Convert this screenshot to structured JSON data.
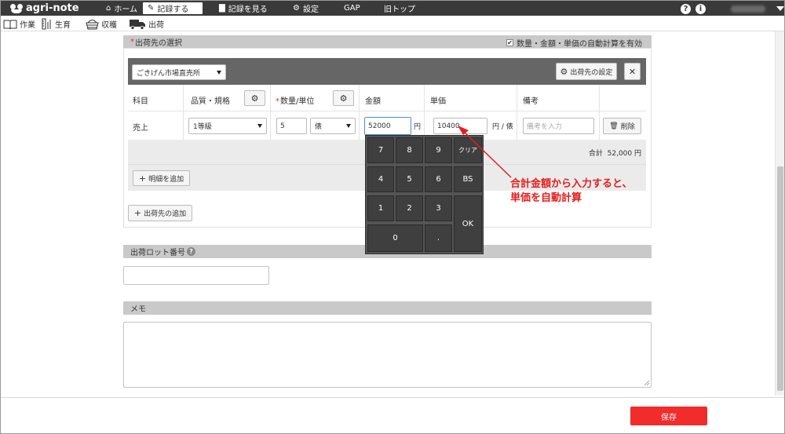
{
  "nav": {
    "brand": "agri-note",
    "home": "ホーム",
    "record": "記録する",
    "view": "記録を見る",
    "settings": "設定",
    "gap": "GAP",
    "old_top": "旧トップ"
  },
  "subnav": {
    "work": "作業",
    "growth": "生育",
    "harvest": "収穫",
    "shipping": "出荷"
  },
  "ship_section": {
    "title": "出荷先の選択",
    "auto_calc_label": "数量・金額・単価の自動計算を有効",
    "auto_calc_checked": true,
    "destination": "ごきげん市場直売所",
    "settings_button": "出荷先の設定",
    "close_button": "✕",
    "columns": {
      "subject": "科目",
      "quality": "品質・規格",
      "quantity": "数量/単位",
      "amount": "金額",
      "unit_price": "単価",
      "note": "備考"
    },
    "row": {
      "subject": "売上",
      "quality": "1等級",
      "quantity": "5",
      "unit": "俵",
      "amount": "52000",
      "amount_unit": "円",
      "unit_price": "10400",
      "unit_price_unit": "円 / 俵",
      "note_placeholder": "備考を入力",
      "delete_button": "削除"
    },
    "total_label": "合計",
    "total_value": "52,000 円",
    "add_line_button": "明細を追加",
    "add_destination_button": "出荷先の追加"
  },
  "numpad": {
    "keys": [
      "7",
      "8",
      "9",
      "クリア",
      "4",
      "5",
      "6",
      "BS",
      "1",
      "2",
      "3",
      "OK",
      "0",
      "."
    ]
  },
  "annotation": {
    "line1": "合計金額から入力すると、",
    "line2": "単価を自動計算"
  },
  "lot_section": {
    "title": "出荷ロット番号",
    "help": "?"
  },
  "memo_section": {
    "title": "メモ"
  },
  "footer": {
    "save_button": "保存"
  },
  "colors": {
    "nav_bg": "#3a3a3a",
    "accent_red": "#f22b2b",
    "annotation_red": "#e41e1e"
  }
}
